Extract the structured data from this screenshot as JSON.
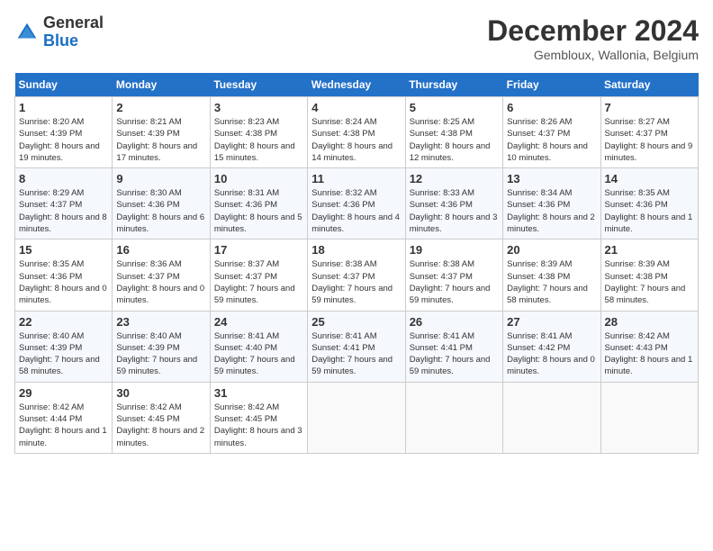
{
  "header": {
    "logo": {
      "general": "General",
      "blue": "Blue"
    },
    "title": "December 2024",
    "location": "Gembloux, Wallonia, Belgium"
  },
  "days_of_week": [
    "Sunday",
    "Monday",
    "Tuesday",
    "Wednesday",
    "Thursday",
    "Friday",
    "Saturday"
  ],
  "weeks": [
    [
      {
        "day": "1",
        "sunrise": "8:20 AM",
        "sunset": "4:39 PM",
        "daylight": "8 hours and 19 minutes."
      },
      {
        "day": "2",
        "sunrise": "8:21 AM",
        "sunset": "4:39 PM",
        "daylight": "8 hours and 17 minutes."
      },
      {
        "day": "3",
        "sunrise": "8:23 AM",
        "sunset": "4:38 PM",
        "daylight": "8 hours and 15 minutes."
      },
      {
        "day": "4",
        "sunrise": "8:24 AM",
        "sunset": "4:38 PM",
        "daylight": "8 hours and 14 minutes."
      },
      {
        "day": "5",
        "sunrise": "8:25 AM",
        "sunset": "4:38 PM",
        "daylight": "8 hours and 12 minutes."
      },
      {
        "day": "6",
        "sunrise": "8:26 AM",
        "sunset": "4:37 PM",
        "daylight": "8 hours and 10 minutes."
      },
      {
        "day": "7",
        "sunrise": "8:27 AM",
        "sunset": "4:37 PM",
        "daylight": "8 hours and 9 minutes."
      }
    ],
    [
      {
        "day": "8",
        "sunrise": "8:29 AM",
        "sunset": "4:37 PM",
        "daylight": "8 hours and 8 minutes."
      },
      {
        "day": "9",
        "sunrise": "8:30 AM",
        "sunset": "4:36 PM",
        "daylight": "8 hours and 6 minutes."
      },
      {
        "day": "10",
        "sunrise": "8:31 AM",
        "sunset": "4:36 PM",
        "daylight": "8 hours and 5 minutes."
      },
      {
        "day": "11",
        "sunrise": "8:32 AM",
        "sunset": "4:36 PM",
        "daylight": "8 hours and 4 minutes."
      },
      {
        "day": "12",
        "sunrise": "8:33 AM",
        "sunset": "4:36 PM",
        "daylight": "8 hours and 3 minutes."
      },
      {
        "day": "13",
        "sunrise": "8:34 AM",
        "sunset": "4:36 PM",
        "daylight": "8 hours and 2 minutes."
      },
      {
        "day": "14",
        "sunrise": "8:35 AM",
        "sunset": "4:36 PM",
        "daylight": "8 hours and 1 minute."
      }
    ],
    [
      {
        "day": "15",
        "sunrise": "8:35 AM",
        "sunset": "4:36 PM",
        "daylight": "8 hours and 0 minutes."
      },
      {
        "day": "16",
        "sunrise": "8:36 AM",
        "sunset": "4:37 PM",
        "daylight": "8 hours and 0 minutes."
      },
      {
        "day": "17",
        "sunrise": "8:37 AM",
        "sunset": "4:37 PM",
        "daylight": "7 hours and 59 minutes."
      },
      {
        "day": "18",
        "sunrise": "8:38 AM",
        "sunset": "4:37 PM",
        "daylight": "7 hours and 59 minutes."
      },
      {
        "day": "19",
        "sunrise": "8:38 AM",
        "sunset": "4:37 PM",
        "daylight": "7 hours and 59 minutes."
      },
      {
        "day": "20",
        "sunrise": "8:39 AM",
        "sunset": "4:38 PM",
        "daylight": "7 hours and 58 minutes."
      },
      {
        "day": "21",
        "sunrise": "8:39 AM",
        "sunset": "4:38 PM",
        "daylight": "7 hours and 58 minutes."
      }
    ],
    [
      {
        "day": "22",
        "sunrise": "8:40 AM",
        "sunset": "4:39 PM",
        "daylight": "7 hours and 58 minutes."
      },
      {
        "day": "23",
        "sunrise": "8:40 AM",
        "sunset": "4:39 PM",
        "daylight": "7 hours and 59 minutes."
      },
      {
        "day": "24",
        "sunrise": "8:41 AM",
        "sunset": "4:40 PM",
        "daylight": "7 hours and 59 minutes."
      },
      {
        "day": "25",
        "sunrise": "8:41 AM",
        "sunset": "4:41 PM",
        "daylight": "7 hours and 59 minutes."
      },
      {
        "day": "26",
        "sunrise": "8:41 AM",
        "sunset": "4:41 PM",
        "daylight": "7 hours and 59 minutes."
      },
      {
        "day": "27",
        "sunrise": "8:41 AM",
        "sunset": "4:42 PM",
        "daylight": "8 hours and 0 minutes."
      },
      {
        "day": "28",
        "sunrise": "8:42 AM",
        "sunset": "4:43 PM",
        "daylight": "8 hours and 1 minute."
      }
    ],
    [
      {
        "day": "29",
        "sunrise": "8:42 AM",
        "sunset": "4:44 PM",
        "daylight": "8 hours and 1 minute."
      },
      {
        "day": "30",
        "sunrise": "8:42 AM",
        "sunset": "4:45 PM",
        "daylight": "8 hours and 2 minutes."
      },
      {
        "day": "31",
        "sunrise": "8:42 AM",
        "sunset": "4:45 PM",
        "daylight": "8 hours and 3 minutes."
      },
      null,
      null,
      null,
      null
    ]
  ],
  "labels": {
    "sunrise": "Sunrise:",
    "sunset": "Sunset:",
    "daylight": "Daylight:"
  }
}
